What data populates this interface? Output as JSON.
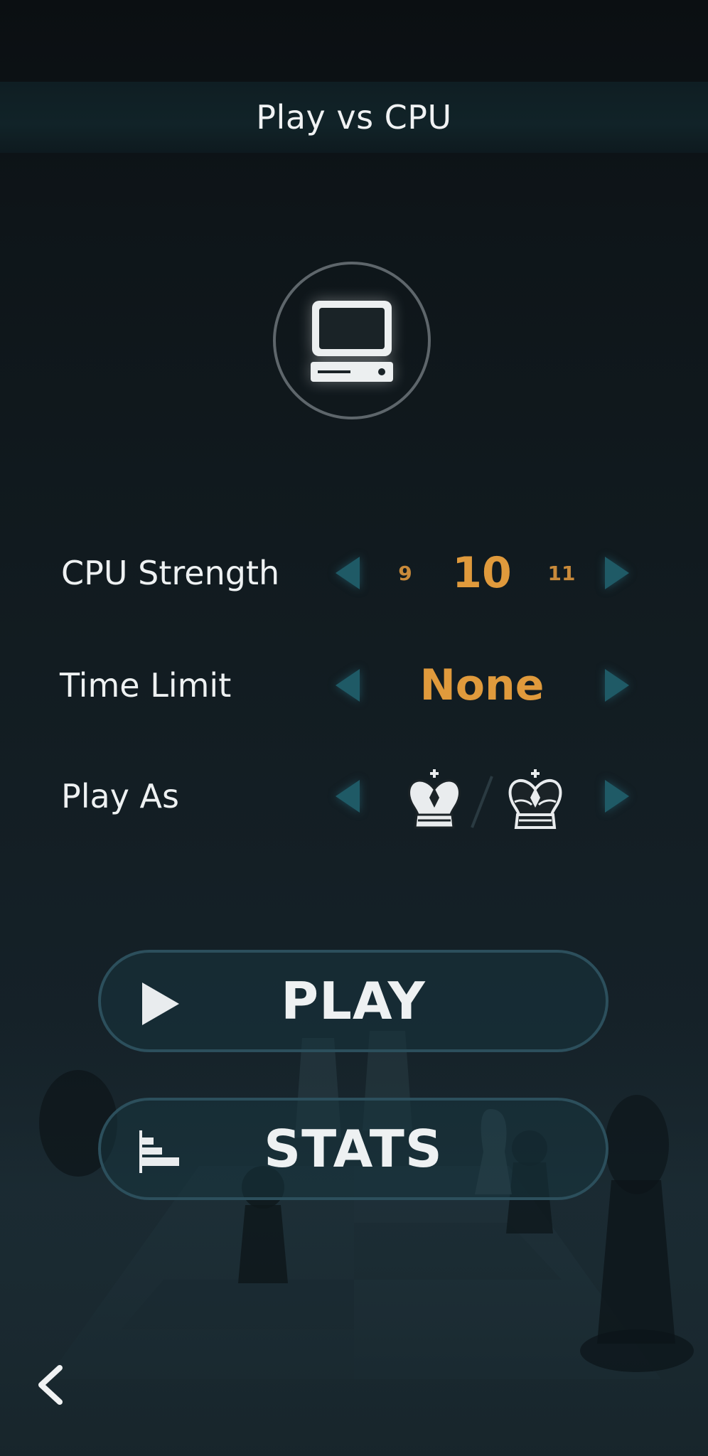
{
  "header": {
    "title": "Play vs CPU"
  },
  "avatar": {
    "icon": "computer-icon"
  },
  "settings": {
    "cpu_strength": {
      "label": "CPU Strength",
      "prev": "9",
      "value": "10",
      "next": "11"
    },
    "time_limit": {
      "label": "Time Limit",
      "value": "None"
    },
    "play_as": {
      "label": "Play As",
      "options": [
        "white-king-icon",
        "black-king-icon"
      ]
    }
  },
  "buttons": {
    "play": "PLAY",
    "stats": "STATS"
  },
  "colors": {
    "accent": "#e09a3c",
    "arrow": "#1f5a66",
    "button_border": "#2c4f5c"
  }
}
